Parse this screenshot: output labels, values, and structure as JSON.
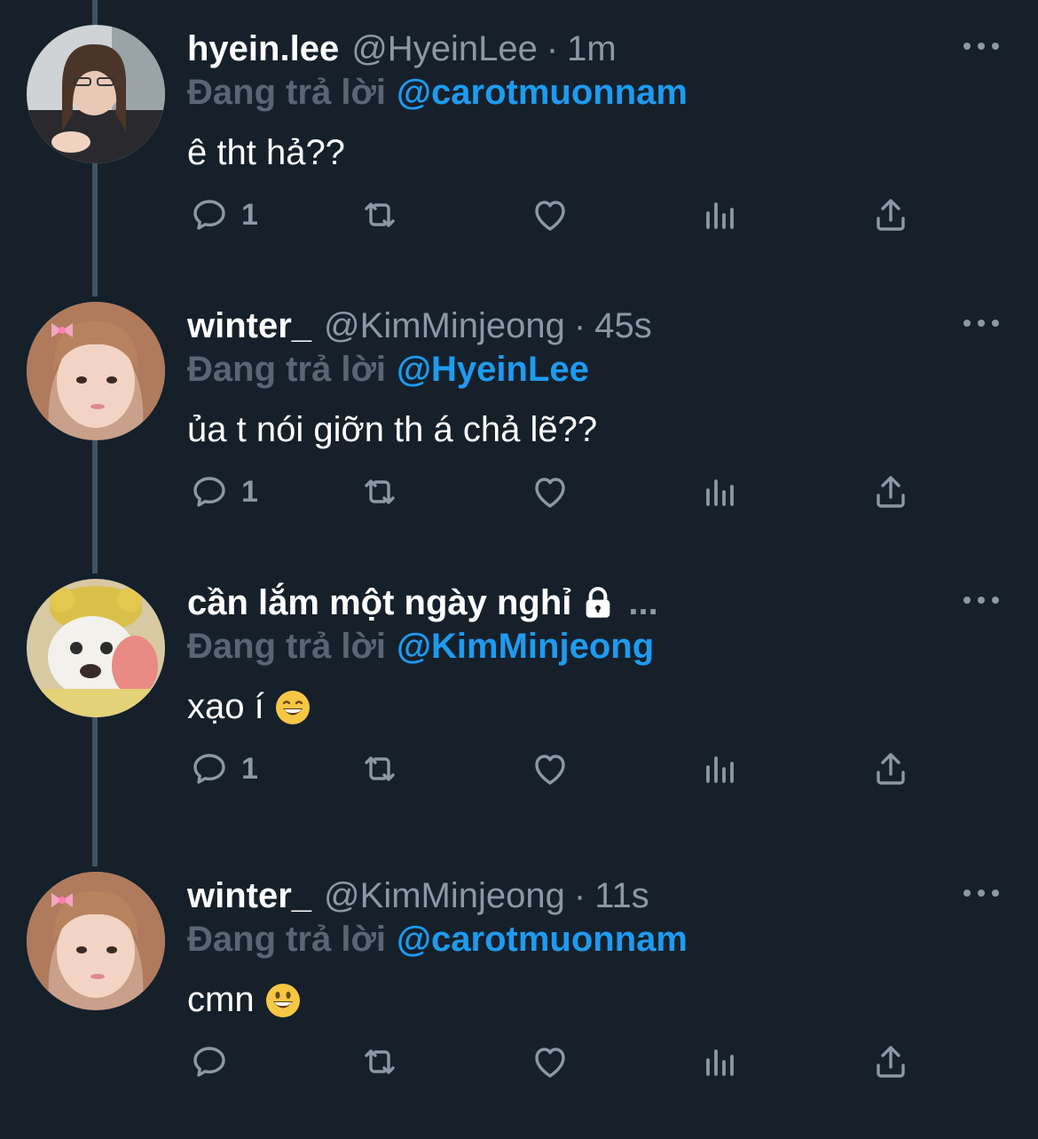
{
  "colors": {
    "background": "#15202b",
    "accent": "#1d9bf0",
    "muted": "#8b98a5",
    "reply_prefix": "#586674"
  },
  "tweets": [
    {
      "display_name": "hyein.lee",
      "handle": "@HyeinLee",
      "separator": "·",
      "time": "1m",
      "reply_prefix": "Đang trả lời",
      "reply_to": "@carotmuonnam",
      "text": "ê tht hả??",
      "reply_count": "1",
      "icons": [
        "reply-icon",
        "retweet-icon",
        "like-icon",
        "views-icon",
        "share-icon",
        "more-icon"
      ]
    },
    {
      "display_name": "winter_",
      "handle": "@KimMinjeong",
      "separator": "·",
      "time": "45s",
      "reply_prefix": "Đang trả lời",
      "reply_to": "@HyeinLee",
      "text": "ủa t nói giỡn th á chả lẽ??",
      "reply_count": "1"
    },
    {
      "display_name": "cần lắm một ngày nghỉ",
      "name_overflow": "...",
      "reply_prefix": "Đang trả lời",
      "reply_to": "@KimMinjeong",
      "text": "xạo í",
      "emoji": "grinning-face-with-smiling-eyes",
      "protected_icon": "lock-icon",
      "reply_count": "1"
    },
    {
      "display_name": "winter_",
      "handle": "@KimMinjeong",
      "separator": "·",
      "time": "11s",
      "reply_prefix": "Đang trả lời",
      "reply_to": "@carotmuonnam",
      "text": "cmn",
      "emoji": "grinning-face",
      "reply_count": ""
    }
  ]
}
